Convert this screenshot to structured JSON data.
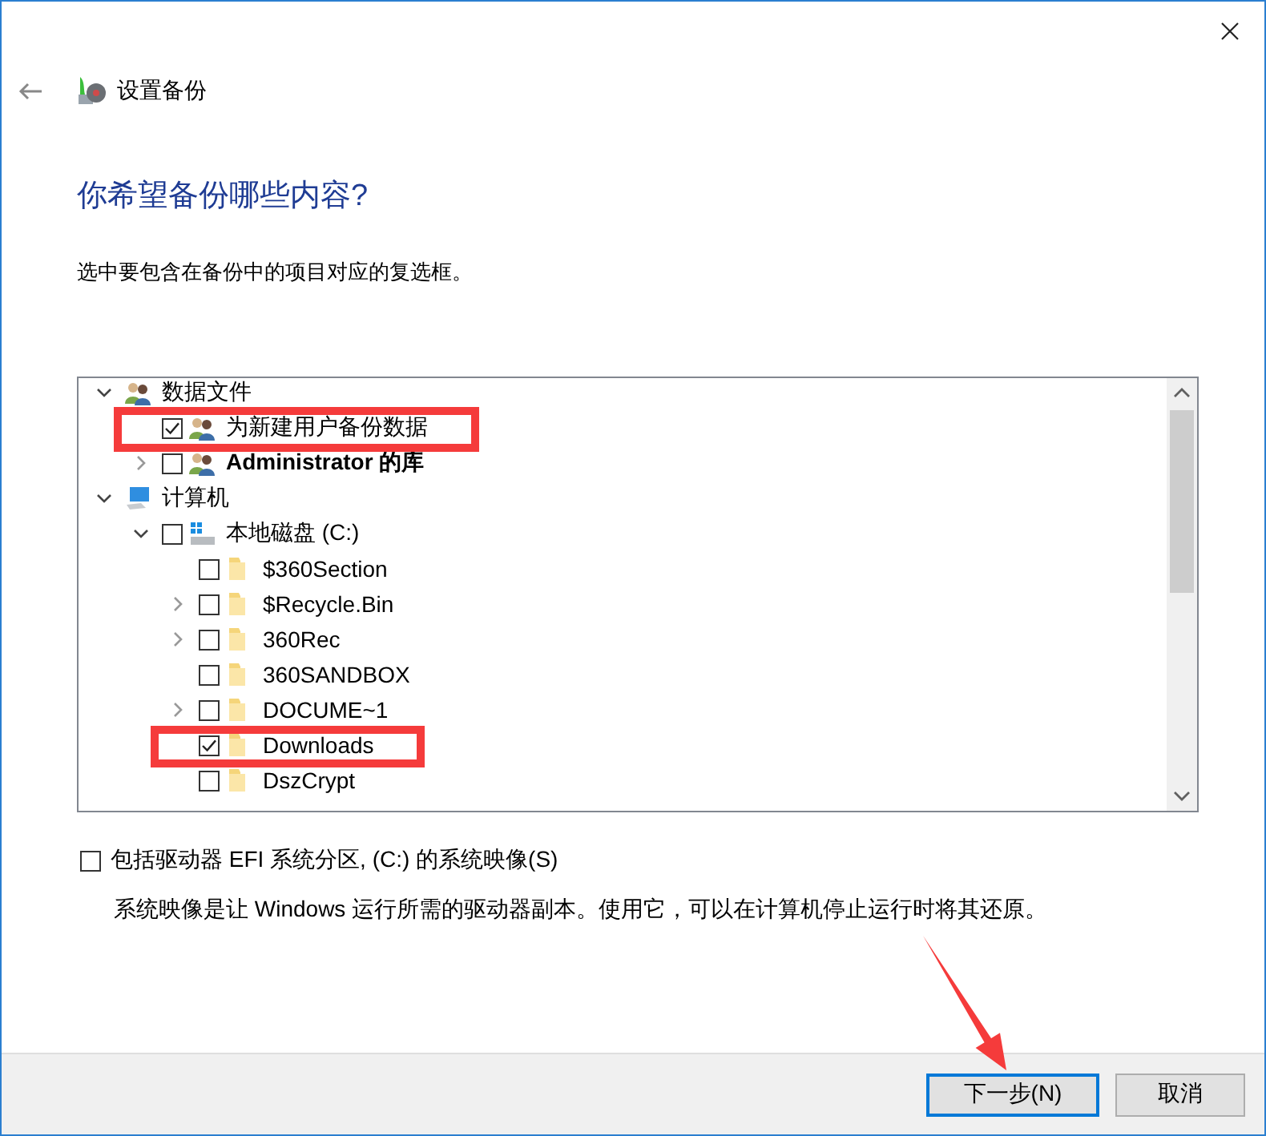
{
  "header": {
    "title": "设置备份"
  },
  "heading": "你希望备份哪些内容?",
  "instruction": "选中要包含在备份中的项目对应的复选框。",
  "tree": [
    {
      "kind": "category",
      "label": "数据文件",
      "expandable": true,
      "expanded": true,
      "bold": false,
      "highlighted": false,
      "children": [
        {
          "kind": "library",
          "label": "为新建用户备份数据",
          "expandable": false,
          "checked": true,
          "bold": false,
          "highlighted": true
        },
        {
          "kind": "library",
          "label": "Administrator 的库",
          "expandable": true,
          "expanded": false,
          "checked": false,
          "bold": true,
          "highlighted": false
        }
      ]
    },
    {
      "kind": "computer",
      "label": "计算机",
      "expandable": true,
      "expanded": true,
      "bold": false,
      "highlighted": false,
      "children": [
        {
          "kind": "drive",
          "label": "本地磁盘 (C:)",
          "expandable": true,
          "expanded": true,
          "checked": false,
          "bold": false,
          "highlighted": false,
          "children": [
            {
              "kind": "folder",
              "label": "$360Section",
              "expandable": false,
              "checked": false,
              "bold": false,
              "highlighted": false
            },
            {
              "kind": "folder",
              "label": "$Recycle.Bin",
              "expandable": true,
              "expanded": false,
              "checked": false,
              "bold": false,
              "highlighted": false
            },
            {
              "kind": "folder",
              "label": "360Rec",
              "expandable": true,
              "expanded": false,
              "checked": false,
              "bold": false,
              "highlighted": false
            },
            {
              "kind": "folder",
              "label": "360SANDBOX",
              "expandable": false,
              "checked": false,
              "bold": false,
              "highlighted": false
            },
            {
              "kind": "folder",
              "label": "DOCUME~1",
              "expandable": true,
              "expanded": false,
              "checked": false,
              "bold": false,
              "highlighted": false
            },
            {
              "kind": "folder",
              "label": "Downloads",
              "expandable": false,
              "checked": true,
              "bold": false,
              "highlighted": true
            },
            {
              "kind": "folder",
              "label": "DszCrypt",
              "expandable": false,
              "checked": false,
              "bold": false,
              "highlighted": false
            }
          ]
        }
      ]
    }
  ],
  "system_image": {
    "label": "包括驱动器 EFI 系统分区, (C:) 的系统映像(S)",
    "checked": false,
    "description": "系统映像是让 Windows 运行所需的驱动器副本。使用它，可以在计算机停止运行时将其还原。"
  },
  "buttons": [
    {
      "label": "下一步(N)",
      "default": true,
      "pointed": true
    },
    {
      "label": "取消",
      "default": false,
      "pointed": false
    }
  ]
}
